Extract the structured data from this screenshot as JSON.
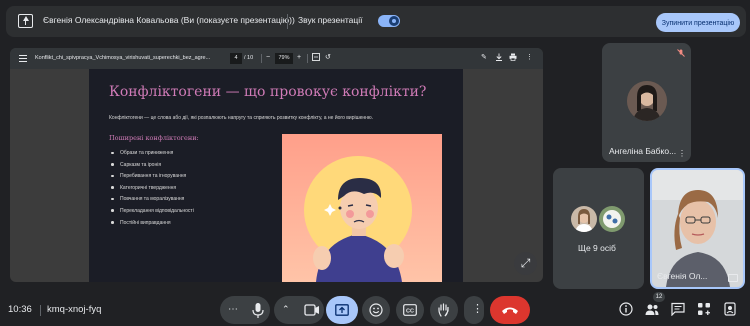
{
  "top_bar": {
    "presentation_label": "Євгенія Олександрівна Ковальова (Ви (показуєте презентацію))",
    "sound_label": "Звук презентації",
    "stop_button": "Зупинити презентацію",
    "sound_toggle_on": true
  },
  "pdf_toolbar": {
    "filename": "Konflikt_chi_spivpracya_Vchimosya_virishuvati_superechki_bez_agre...",
    "page_current": "4",
    "page_total": "/ 10",
    "zoom": "79%"
  },
  "slide": {
    "title": "Конфліктогени — що провокує конфлікти?",
    "intro": "Конфліктогени — це слова або дії, які розпалюють напругу та сприяють розвитку конфлікту, а не його вирішенню.",
    "subtitle": "Поширені конфліктогени:",
    "items": [
      "Образи та приниження",
      "Сарказм та іронія",
      "Перебивання та ігнорування",
      "Категоричні твердження",
      "Повчання та моралізування",
      "Перекладання відповідальності",
      "Постійні виправдання"
    ]
  },
  "participants": {
    "angelina": "Ангеліна Бабко...",
    "others": "Ще 9 осіб",
    "self": "Євгенія Ол..."
  },
  "bottom_bar": {
    "time": "10:36",
    "meeting_code": "kmq-xnoj-fyq",
    "participant_count": "12"
  },
  "colors": {
    "accent": "#a8c7fa",
    "end_call": "#dc362e",
    "slide_title": "#d07bb7"
  },
  "icons": {
    "share": "present-screen-icon",
    "mic": "microphone-icon",
    "camera": "camera-icon",
    "present": "present-to-all-icon",
    "emoji": "emoji-icon",
    "captions": "closed-captions-icon",
    "hand": "raise-hand-icon",
    "end": "end-call-icon"
  }
}
